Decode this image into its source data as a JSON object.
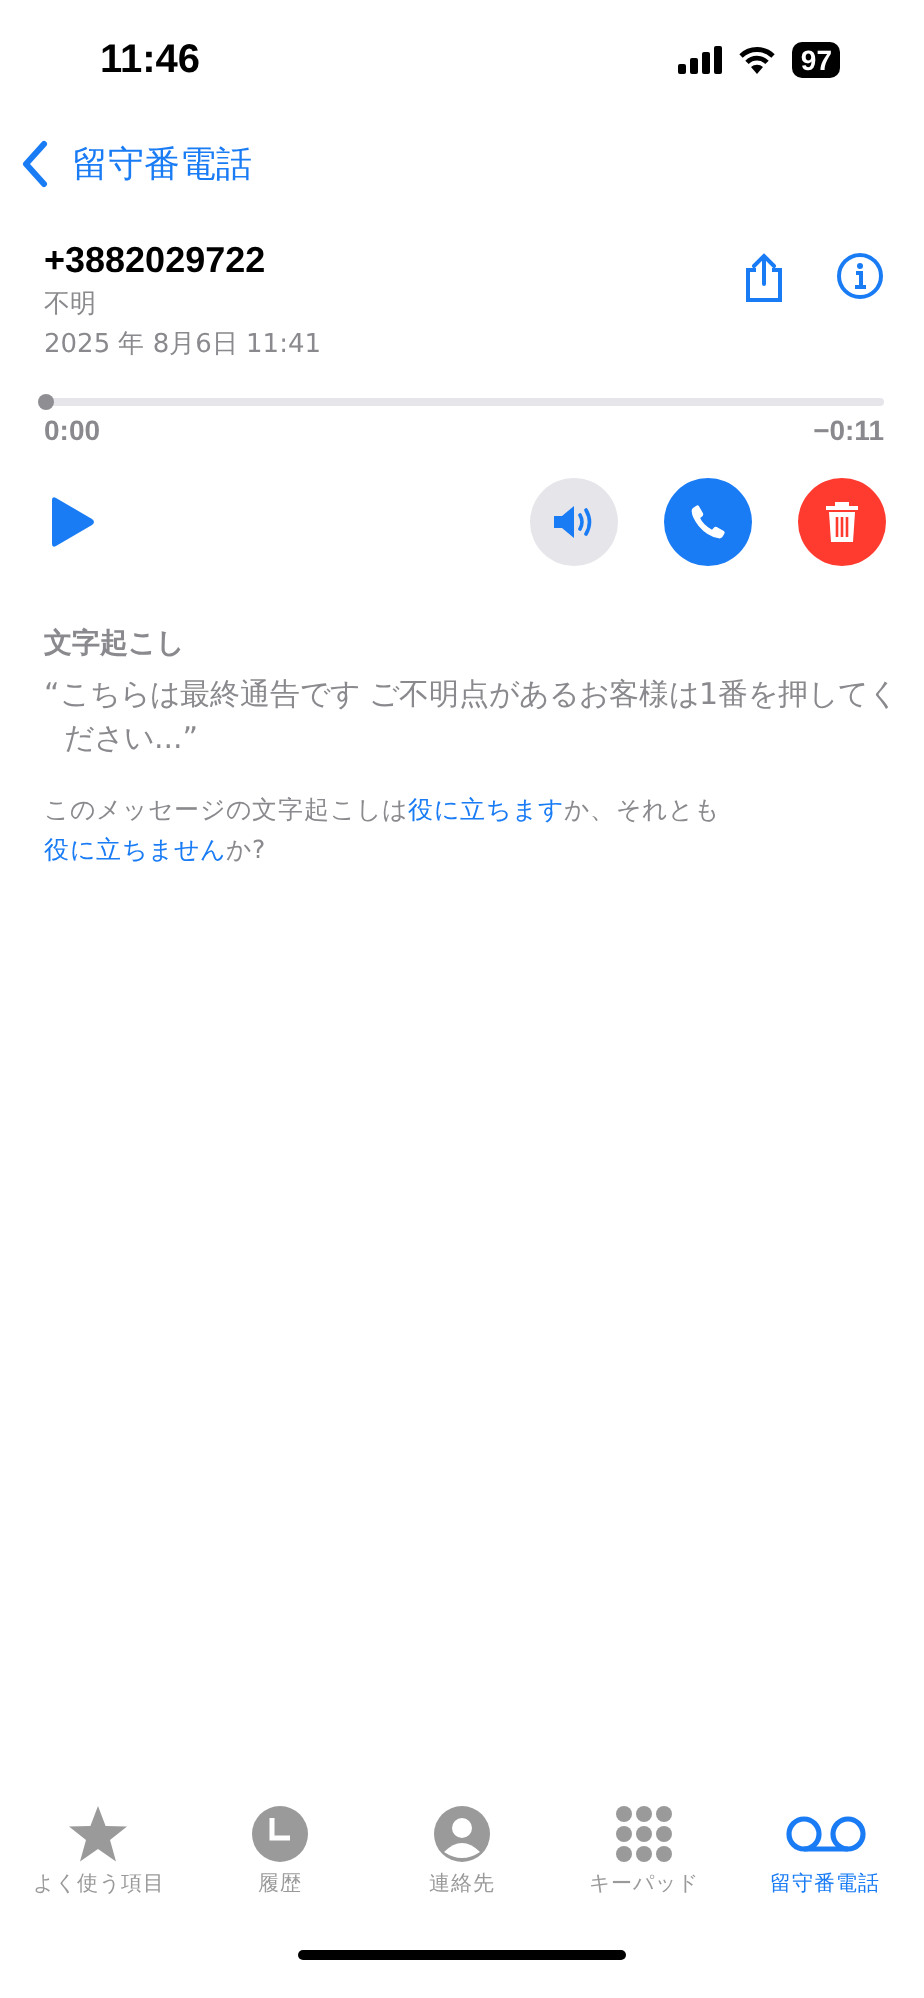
{
  "status_bar": {
    "time": "11:46",
    "battery": "97"
  },
  "nav": {
    "back_label": "留守番電話"
  },
  "message": {
    "number": "+3882029722",
    "label": "不明",
    "date": "2025 年 8月6日 11:41"
  },
  "playback": {
    "level": 0,
    "elapsed": "0:00",
    "remaining": "−0:11",
    "speaker_on": false
  },
  "transcript": {
    "heading": "文字起こし",
    "text": "“こちらは最終通告です ご不明点があるお客様は1番を押してください...”"
  },
  "feedback": [
    {
      "kind": "text",
      "text": "このメッセージの文字起こしは"
    },
    {
      "kind": "link",
      "text": "役に立ちます"
    },
    {
      "kind": "text",
      "text": "か、それとも"
    },
    {
      "kind": "link",
      "text": "役に立ちません"
    },
    {
      "kind": "text",
      "text": "か?"
    }
  ],
  "tabs": [
    {
      "label": "よく使う項目",
      "selected": false
    },
    {
      "label": "履歴",
      "selected": false
    },
    {
      "label": "連絡先",
      "selected": false
    },
    {
      "label": "キーパッド",
      "selected": false
    },
    {
      "label": "留守番電話",
      "selected": true
    }
  ]
}
